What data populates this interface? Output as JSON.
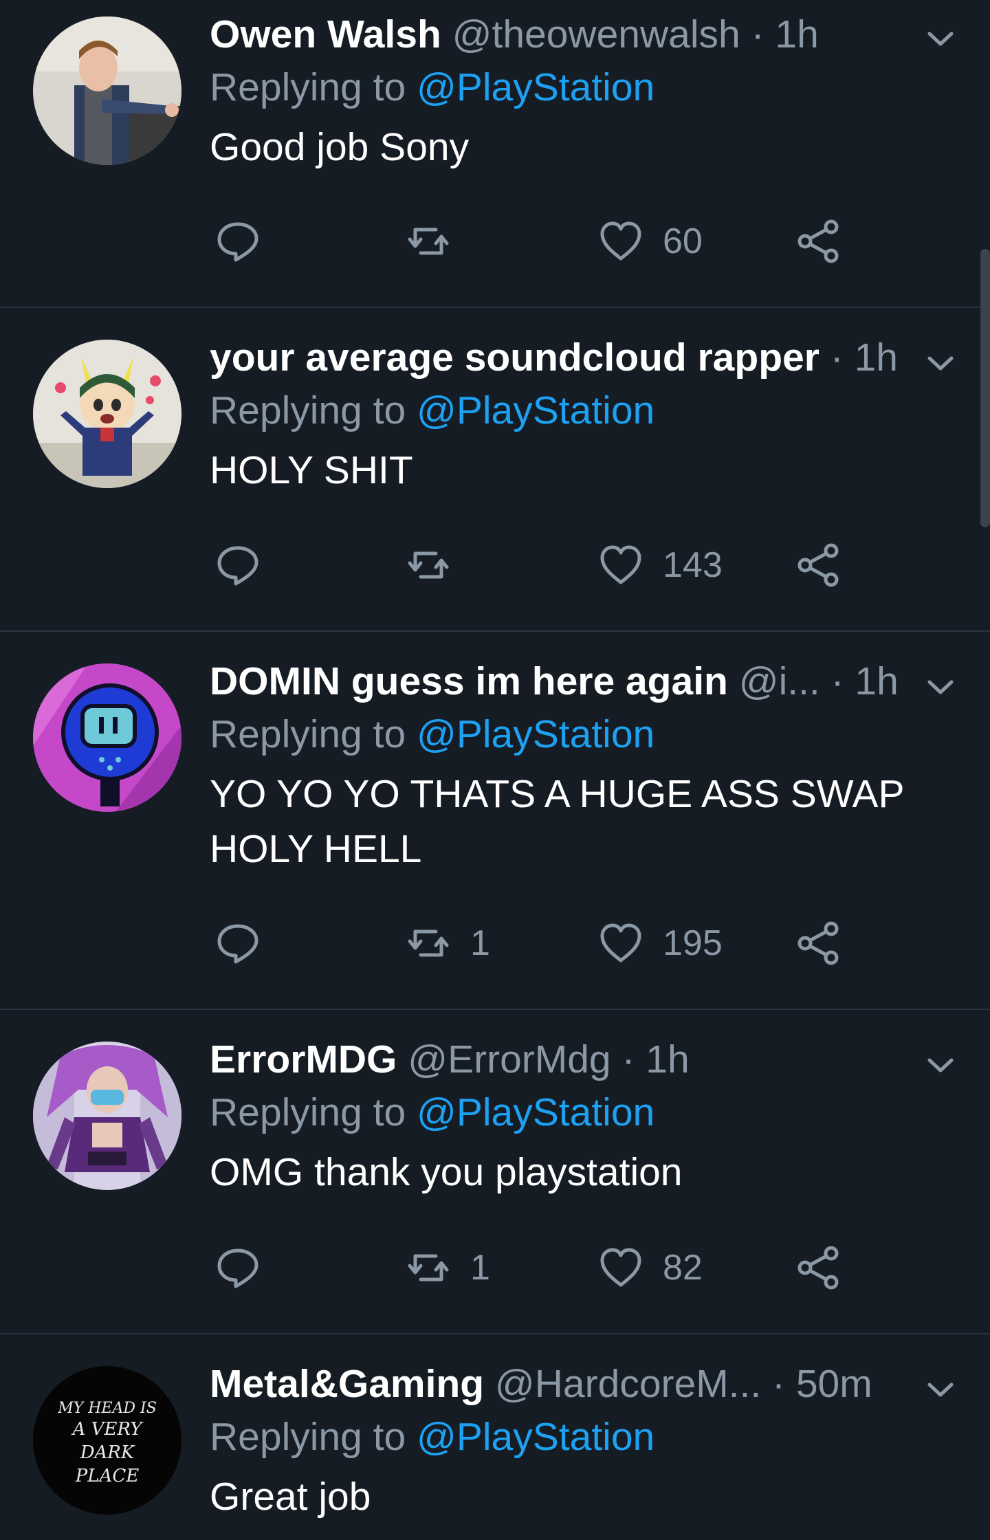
{
  "tweets": [
    {
      "display_name": "Owen Walsh",
      "handle": "@theowenwalsh",
      "separator": " · ",
      "time": "1h",
      "replying_prefix": "Replying to ",
      "replying_to": "@PlayStation",
      "text": "Good job Sony",
      "reply_count": "",
      "retweet_count": "",
      "like_count": "60"
    },
    {
      "display_name": "your average soundcloud rapper",
      "handle": "",
      "separator": " · ",
      "time": "1h",
      "replying_prefix": "Replying to ",
      "replying_to": "@PlayStation",
      "text": "HOLY SHIT",
      "reply_count": "",
      "retweet_count": "",
      "like_count": "143"
    },
    {
      "display_name": "DOMIN guess im here again",
      "handle": "@i...",
      "separator": " · ",
      "time": "1h",
      "replying_prefix": "Replying to ",
      "replying_to": "@PlayStation",
      "text": "YO YO YO THATS A HUGE ASS SWAP HOLY HELL",
      "reply_count": "",
      "retweet_count": "1",
      "like_count": "195"
    },
    {
      "display_name": "ErrorMDG",
      "handle": "@ErrorMdg",
      "separator": " · ",
      "time": "1h",
      "replying_prefix": "Replying to ",
      "replying_to": "@PlayStation",
      "text": "OMG thank you playstation",
      "reply_count": "",
      "retweet_count": "1",
      "like_count": "82"
    },
    {
      "display_name": "Metal&Gaming",
      "handle": "@HardcoreM...",
      "separator": " · ",
      "time": "50m",
      "replying_prefix": "Replying to ",
      "replying_to": "@PlayStation",
      "text": "Great job",
      "reply_count": "",
      "retweet_count": "",
      "like_count": ""
    }
  ],
  "avatar_texts": {
    "metal_gaming": [
      "MY HEAD IS",
      "A VERY",
      "DARK",
      "PLACE"
    ]
  },
  "icons": {
    "reply": "reply-icon",
    "retweet": "retweet-icon",
    "like": "heart-icon",
    "share": "share-icon",
    "menu": "chevron-down-icon"
  },
  "colors": {
    "background": "#151c24",
    "text": "#ffffff",
    "muted": "#8b98a5",
    "accent": "#1da1f2",
    "divider": "#2a3340"
  }
}
